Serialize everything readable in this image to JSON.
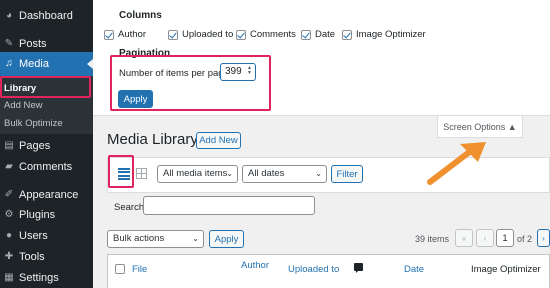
{
  "sidebar": {
    "items": [
      {
        "label": "Dashboard",
        "icon": "dashboard-icon"
      },
      {
        "label": "Posts",
        "icon": "pin-icon"
      },
      {
        "label": "Media",
        "icon": "media-icon"
      },
      {
        "label": "Pages",
        "icon": "page-icon"
      },
      {
        "label": "Comments",
        "icon": "comment-icon"
      },
      {
        "label": "Appearance",
        "icon": "brush-icon"
      },
      {
        "label": "Plugins",
        "icon": "plugin-icon"
      },
      {
        "label": "Users",
        "icon": "user-icon"
      },
      {
        "label": "Tools",
        "icon": "wrench-icon"
      },
      {
        "label": "Settings",
        "icon": "settings-icon"
      }
    ],
    "submenu": [
      "Library",
      "Add New",
      "Bulk Optimize"
    ]
  },
  "screen_options": {
    "columns_heading": "Columns",
    "columns": [
      "Author",
      "Uploaded to",
      "Comments",
      "Date",
      "Image Optimizer"
    ],
    "pagination_heading": "Pagination",
    "per_page_label": "Number of items per page:",
    "per_page_value": "399",
    "apply_label": "Apply",
    "tab_label": "Screen Options ▲"
  },
  "library": {
    "title": "Media Library",
    "add_new": "Add New",
    "filter_type": "All media items",
    "filter_date": "All dates",
    "filter_button": "Filter",
    "search_label": "Search",
    "bulk_actions": "Bulk actions",
    "apply_label": "Apply",
    "items_count": "39 items",
    "page_first": "«",
    "page_prev": "‹",
    "current_page": "1",
    "of_pages": "of 2",
    "page_next": "›",
    "columns": {
      "file": "File",
      "author": "Author",
      "uploaded_to": "Uploaded to",
      "date": "Date",
      "image_optimizer": "Image Optimizer"
    }
  },
  "colors": {
    "accent": "#2271b1",
    "highlight": "#e0245e",
    "arrow": "#f0902e",
    "sidebar": "#1d2327"
  }
}
